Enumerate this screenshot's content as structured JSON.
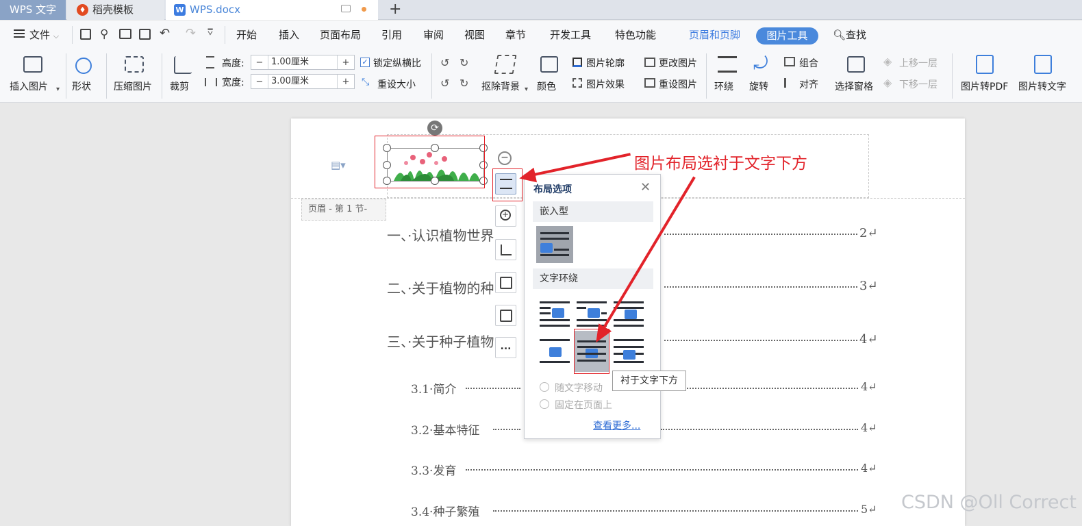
{
  "tabs": {
    "app": "WPS 文字",
    "template": "稻壳模板",
    "document": "WPS.docx"
  },
  "menu": {
    "file": "文件",
    "items": [
      "开始",
      "插入",
      "页面布局",
      "引用",
      "审阅",
      "视图",
      "章节",
      "开发工具",
      "特色功能"
    ],
    "header_footer": "页眉和页脚",
    "image_tool": "图片工具",
    "search": "查找"
  },
  "ribbon": {
    "insert_image": "插入图片",
    "shape": "形状",
    "compress": "压缩图片",
    "crop": "裁剪",
    "height_label": "高度:",
    "height_value": "1.00厘米",
    "width_label": "宽度:",
    "width_value": "3.00厘米",
    "lock_ratio": "锁定纵横比",
    "reset_size": "重设大小",
    "remove_bg": "抠除背景",
    "color": "颜色",
    "outline": "图片轮廓",
    "effect": "图片效果",
    "change_image": "更改图片",
    "reset_image": "重设图片",
    "wrap": "环绕",
    "rotate": "旋转",
    "group": "组合",
    "align": "对齐",
    "selection_pane": "选择窗格",
    "bring_forward": "上移一层",
    "send_backward": "下移一层",
    "to_pdf": "图片转PDF",
    "to_text": "图片转文字",
    "minus": "−",
    "plus": "+"
  },
  "document": {
    "header_tag": "页眉 - 第 1 节-",
    "toc": [
      {
        "text": "一、·认识植物世界",
        "page": "2↵"
      },
      {
        "text": "二、·关于植物的种",
        "page": "3↵"
      },
      {
        "text": "三、·关于种子植物",
        "page": "4↵"
      },
      {
        "text": "3.1·简介",
        "page": "4↵"
      },
      {
        "text": "3.2·基本特征",
        "page": "4↵"
      },
      {
        "text": "3.3·发育",
        "page": "4↵"
      },
      {
        "text": "3.4·种子繁殖",
        "page": "5↵"
      }
    ]
  },
  "popup": {
    "title": "布局选项",
    "inline": "嵌入型",
    "wrap_text": "文字环绕",
    "move_with_text": "随文字移动",
    "fix_on_page": "固定在页面上",
    "more": "查看更多...",
    "tooltip": "衬于文字下方"
  },
  "side_toolbar": {
    "more": "..."
  },
  "annotation": "图片布局选衬于文字下方",
  "watermark": "CSDN @Oll Correct",
  "colors": {
    "accent": "#4a89dc",
    "annotation": "#e2232a"
  }
}
